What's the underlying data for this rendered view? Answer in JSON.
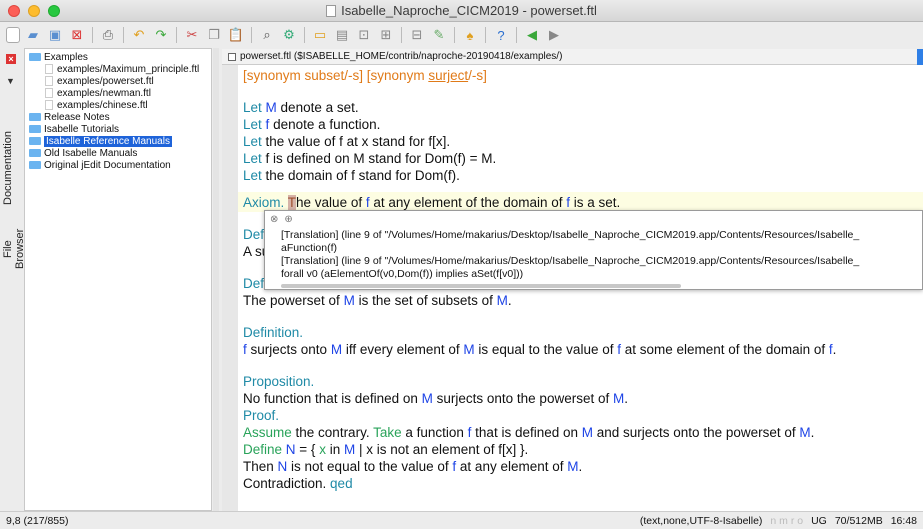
{
  "window": {
    "title": "Isabelle_Naproche_CICM2019 - powerset.ftl"
  },
  "toolbar": {
    "icons": [
      "new-file",
      "open",
      "save",
      "close-file",
      "print",
      "undo",
      "redo",
      "cut",
      "copy",
      "paste",
      "find",
      "find-in-files",
      "indent",
      "unindent",
      "fold",
      "expand",
      "zoom",
      "macro",
      "plugin",
      "help",
      "back",
      "forward"
    ]
  },
  "dock": {
    "tab_documentation": "Documentation",
    "tab_file_browser": "File Browser"
  },
  "tree": {
    "items": [
      {
        "label": "Examples",
        "type": "folder",
        "indent": 0
      },
      {
        "label": "examples/Maximum_principle.ftl",
        "type": "file",
        "indent": 1
      },
      {
        "label": "examples/powerset.ftl",
        "type": "file",
        "indent": 1
      },
      {
        "label": "examples/newman.ftl",
        "type": "file",
        "indent": 1
      },
      {
        "label": "examples/chinese.ftl",
        "type": "file",
        "indent": 1
      },
      {
        "label": "Release Notes",
        "type": "folder",
        "indent": 0
      },
      {
        "label": "Isabelle Tutorials",
        "type": "folder",
        "indent": 0
      },
      {
        "label": "Isabelle Reference Manuals",
        "type": "folder",
        "indent": 0,
        "selected": true
      },
      {
        "label": "Old Isabelle Manuals",
        "type": "folder",
        "indent": 0
      },
      {
        "label": "Original jEdit Documentation",
        "type": "folder",
        "indent": 0
      }
    ]
  },
  "editor": {
    "tab_label": "powerset.ftl ($ISABELLE_HOME/contrib/naproche-20190418/examples/)",
    "l1a": "[synonym subset/-s] [synonym ",
    "l1b": "surject",
    "l1c": "/-s]",
    "let": "Let",
    "l2b": " denote a set.",
    "l3b": " denote a function.",
    "l4b": " the value of f at x stand for f[x].",
    "l5b": " f is defined on M stand for Dom(f) = M.",
    "l6b": " the domain of f stand for Dom(f).",
    "axiom": "Axiom.",
    "ax_cursor": "T",
    "ax1": "he value of ",
    "ax2": " at any element of the domain of ",
    "ax3": " is a set.",
    "def_partial": "Def",
    "a_partial": "A su",
    "def2_partial": "Def",
    "pow_a": "The powerset of ",
    "pow_b": " is the set of subsets of ",
    "pow_c": ".",
    "definition": "Definition.",
    "surj_a": " surjects onto ",
    "surj_b": " iff every element of ",
    "surj_c": " is equal to the value of ",
    "surj_d": " at some element of the domain of ",
    "surj_e": ".",
    "proposition": "Proposition.",
    "prop_a": "No function that is defined on ",
    "prop_b": " surjects onto the powerset of ",
    "prop_c": ".",
    "proof": "Proof.",
    "assume": "Assume",
    "asm_a": " the contrary. ",
    "take": "Take",
    "asm_b": " a function ",
    "asm_c": " that is defined on ",
    "asm_d": " and surjects onto the powerset of ",
    "asm_e": ".",
    "define": "Define",
    "N": "N",
    "def_a": " = { ",
    "x": "x",
    "def_b": " in ",
    "def_c": " | x is not an element of f[x] }.",
    "then_a": "Then ",
    "then_b": " is not equal to the value of ",
    "then_c": " at any element of ",
    "then_d": ".",
    "contradiction": "Contradiction. ",
    "qed": "qed",
    "var_M": "M",
    "var_f": "f"
  },
  "tooltip": {
    "l1": "[Translation] (line 9 of \"/Volumes/Home/makarius/Desktop/Isabelle_Naproche_CICM2019.app/Contents/Resources/Isabelle_",
    "l2": "aFunction(f)",
    "l3": "[Translation] (line 9 of \"/Volumes/Home/makarius/Desktop/Isabelle_Naproche_CICM2019.app/Contents/Resources/Isabelle_",
    "l4": "forall v0 (aElementOf(v0,Dom(f)) implies aSet(f[v0]))"
  },
  "status": {
    "position": "9,8 (217/855)",
    "mode": "(text,none,UTF-8-Isabelle)",
    "flags_dim": "n m r o",
    "flags": "UG",
    "memory": "70/512MB",
    "time": "16:48"
  },
  "colors": {
    "keyword": "#1f8aa6",
    "variable": "#1e44e6",
    "synonym": "#e07a18",
    "selection": "#1e63d9"
  }
}
